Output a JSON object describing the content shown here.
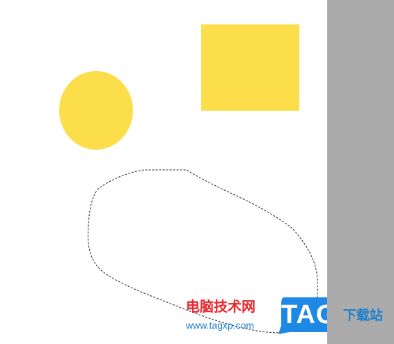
{
  "colors": {
    "canvas": "#ffffff",
    "pasteboard": "#ababab",
    "shape_fill": "#fcde4a",
    "lasso": "#222222",
    "watermark_red": "#e8262e",
    "watermark_blue": "#1b7fcf",
    "tag_badge": "#1e88e5",
    "tag_text": "#ffffff"
  },
  "canvas": {
    "shapes": [
      {
        "kind": "ellipse",
        "name": "yellow-ellipse"
      },
      {
        "kind": "rectangle",
        "name": "yellow-rectangle"
      }
    ],
    "selection": {
      "kind": "lasso",
      "style": "dashed"
    }
  },
  "watermark": {
    "site_name_cn": "电脑技术网",
    "url": "www.tagxp.com",
    "logo_text": "TAG",
    "download_cn": "下载站",
    "logo_icon": "tag-logo-icon"
  }
}
